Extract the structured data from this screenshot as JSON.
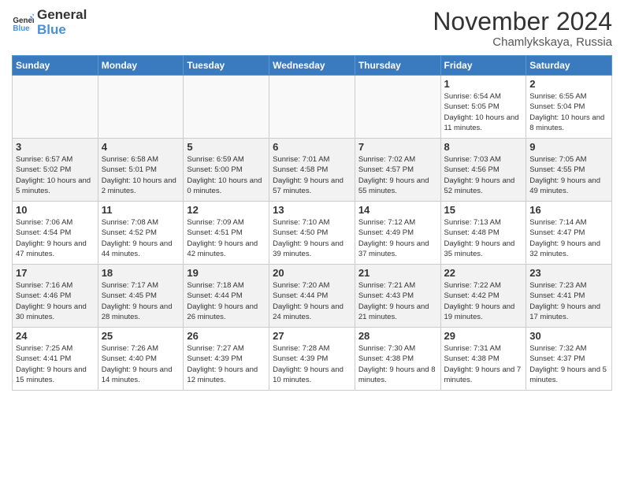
{
  "header": {
    "logo_line1": "General",
    "logo_line2": "Blue",
    "month_title": "November 2024",
    "location": "Chamlykskaya, Russia"
  },
  "weekdays": [
    "Sunday",
    "Monday",
    "Tuesday",
    "Wednesday",
    "Thursday",
    "Friday",
    "Saturday"
  ],
  "weeks": [
    [
      {
        "day": "",
        "info": ""
      },
      {
        "day": "",
        "info": ""
      },
      {
        "day": "",
        "info": ""
      },
      {
        "day": "",
        "info": ""
      },
      {
        "day": "",
        "info": ""
      },
      {
        "day": "1",
        "info": "Sunrise: 6:54 AM\nSunset: 5:05 PM\nDaylight: 10 hours and 11 minutes."
      },
      {
        "day": "2",
        "info": "Sunrise: 6:55 AM\nSunset: 5:04 PM\nDaylight: 10 hours and 8 minutes."
      }
    ],
    [
      {
        "day": "3",
        "info": "Sunrise: 6:57 AM\nSunset: 5:02 PM\nDaylight: 10 hours and 5 minutes."
      },
      {
        "day": "4",
        "info": "Sunrise: 6:58 AM\nSunset: 5:01 PM\nDaylight: 10 hours and 2 minutes."
      },
      {
        "day": "5",
        "info": "Sunrise: 6:59 AM\nSunset: 5:00 PM\nDaylight: 10 hours and 0 minutes."
      },
      {
        "day": "6",
        "info": "Sunrise: 7:01 AM\nSunset: 4:58 PM\nDaylight: 9 hours and 57 minutes."
      },
      {
        "day": "7",
        "info": "Sunrise: 7:02 AM\nSunset: 4:57 PM\nDaylight: 9 hours and 55 minutes."
      },
      {
        "day": "8",
        "info": "Sunrise: 7:03 AM\nSunset: 4:56 PM\nDaylight: 9 hours and 52 minutes."
      },
      {
        "day": "9",
        "info": "Sunrise: 7:05 AM\nSunset: 4:55 PM\nDaylight: 9 hours and 49 minutes."
      }
    ],
    [
      {
        "day": "10",
        "info": "Sunrise: 7:06 AM\nSunset: 4:54 PM\nDaylight: 9 hours and 47 minutes."
      },
      {
        "day": "11",
        "info": "Sunrise: 7:08 AM\nSunset: 4:52 PM\nDaylight: 9 hours and 44 minutes."
      },
      {
        "day": "12",
        "info": "Sunrise: 7:09 AM\nSunset: 4:51 PM\nDaylight: 9 hours and 42 minutes."
      },
      {
        "day": "13",
        "info": "Sunrise: 7:10 AM\nSunset: 4:50 PM\nDaylight: 9 hours and 39 minutes."
      },
      {
        "day": "14",
        "info": "Sunrise: 7:12 AM\nSunset: 4:49 PM\nDaylight: 9 hours and 37 minutes."
      },
      {
        "day": "15",
        "info": "Sunrise: 7:13 AM\nSunset: 4:48 PM\nDaylight: 9 hours and 35 minutes."
      },
      {
        "day": "16",
        "info": "Sunrise: 7:14 AM\nSunset: 4:47 PM\nDaylight: 9 hours and 32 minutes."
      }
    ],
    [
      {
        "day": "17",
        "info": "Sunrise: 7:16 AM\nSunset: 4:46 PM\nDaylight: 9 hours and 30 minutes."
      },
      {
        "day": "18",
        "info": "Sunrise: 7:17 AM\nSunset: 4:45 PM\nDaylight: 9 hours and 28 minutes."
      },
      {
        "day": "19",
        "info": "Sunrise: 7:18 AM\nSunset: 4:44 PM\nDaylight: 9 hours and 26 minutes."
      },
      {
        "day": "20",
        "info": "Sunrise: 7:20 AM\nSunset: 4:44 PM\nDaylight: 9 hours and 24 minutes."
      },
      {
        "day": "21",
        "info": "Sunrise: 7:21 AM\nSunset: 4:43 PM\nDaylight: 9 hours and 21 minutes."
      },
      {
        "day": "22",
        "info": "Sunrise: 7:22 AM\nSunset: 4:42 PM\nDaylight: 9 hours and 19 minutes."
      },
      {
        "day": "23",
        "info": "Sunrise: 7:23 AM\nSunset: 4:41 PM\nDaylight: 9 hours and 17 minutes."
      }
    ],
    [
      {
        "day": "24",
        "info": "Sunrise: 7:25 AM\nSunset: 4:41 PM\nDaylight: 9 hours and 15 minutes."
      },
      {
        "day": "25",
        "info": "Sunrise: 7:26 AM\nSunset: 4:40 PM\nDaylight: 9 hours and 14 minutes."
      },
      {
        "day": "26",
        "info": "Sunrise: 7:27 AM\nSunset: 4:39 PM\nDaylight: 9 hours and 12 minutes."
      },
      {
        "day": "27",
        "info": "Sunrise: 7:28 AM\nSunset: 4:39 PM\nDaylight: 9 hours and 10 minutes."
      },
      {
        "day": "28",
        "info": "Sunrise: 7:30 AM\nSunset: 4:38 PM\nDaylight: 9 hours and 8 minutes."
      },
      {
        "day": "29",
        "info": "Sunrise: 7:31 AM\nSunset: 4:38 PM\nDaylight: 9 hours and 7 minutes."
      },
      {
        "day": "30",
        "info": "Sunrise: 7:32 AM\nSunset: 4:37 PM\nDaylight: 9 hours and 5 minutes."
      }
    ]
  ]
}
